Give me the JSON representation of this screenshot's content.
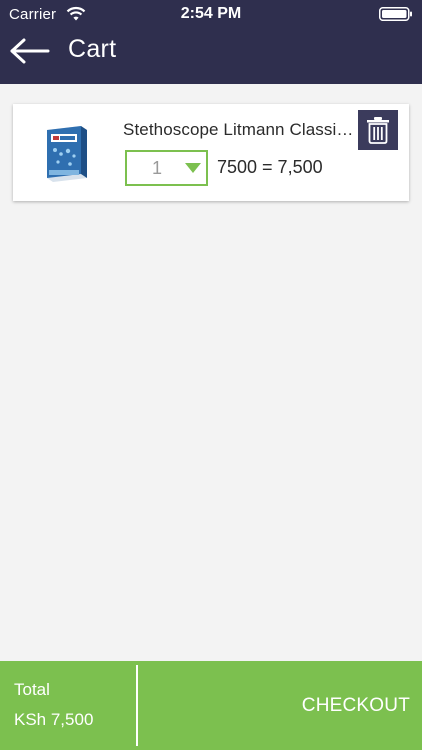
{
  "status_bar": {
    "carrier": "Carrier",
    "time": "2:54 PM"
  },
  "header": {
    "title": "Cart",
    "back_icon": "arrow-left-icon"
  },
  "cart": {
    "items": [
      {
        "name": "Stethoscope Litmann Classic III",
        "quantity": "1",
        "line_total": "7500 = 7,500",
        "thumbnail_icon": "product-box-image",
        "delete_icon": "trash-icon"
      }
    ]
  },
  "footer": {
    "total_label": "Total",
    "total_amount": "KSh 7,500",
    "checkout_label": "CHECKOUT"
  },
  "colors": {
    "header_bg": "#2f2f4e",
    "accent_green": "#7cc04f",
    "page_bg": "#f3f3f3",
    "delete_button_bg": "#3b3b5c"
  }
}
